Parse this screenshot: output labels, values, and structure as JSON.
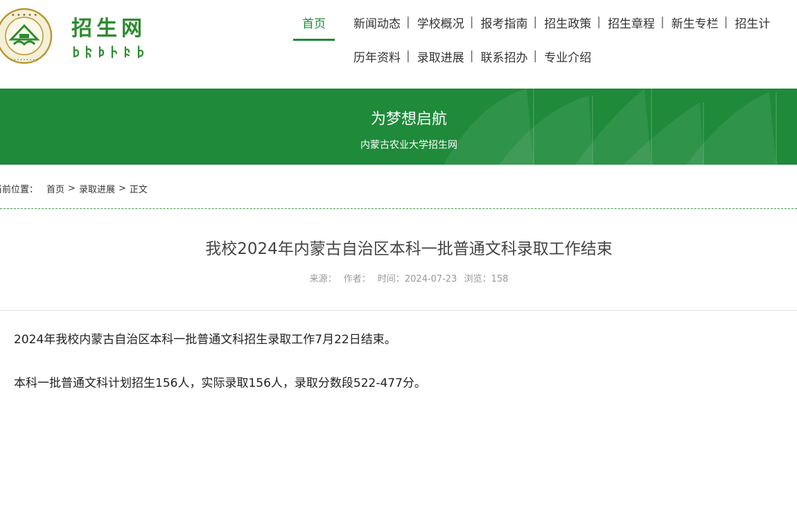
{
  "logo": {
    "title": "招生网"
  },
  "nav": {
    "row1": [
      {
        "label": "首页",
        "active": true
      },
      {
        "label": "新闻动态"
      },
      {
        "label": "学校概况"
      },
      {
        "label": "报考指南"
      },
      {
        "label": "招生政策"
      },
      {
        "label": "招生章程"
      },
      {
        "label": "新生专栏"
      },
      {
        "label": "招生计"
      }
    ],
    "row2": [
      {
        "label": "历年资料"
      },
      {
        "label": "录取进展"
      },
      {
        "label": "联系招办"
      },
      {
        "label": "专业介绍"
      }
    ],
    "separator": "|"
  },
  "banner": {
    "title": "为梦想启航",
    "subtitle": "内蒙古农业大学招生网"
  },
  "breadcrumb": {
    "label": "当前位置：",
    "items": [
      "首页",
      "录取进展",
      "正文"
    ],
    "separator": ">"
  },
  "article": {
    "title": "我校2024年内蒙古自治区本科一批普通文科录取工作结束",
    "meta": {
      "source": "来源：",
      "author": "作者：",
      "time": "时间：2024-07-23",
      "views": "浏览：158"
    },
    "paragraphs": [
      "2024年我校内蒙古自治区本科一批普通文科招生录取工作7月22日结束。",
      "本科一批普通文科计划招生156人，实际录取156人，录取分数段522-477分。"
    ]
  },
  "colors": {
    "brand_green": "#1e8a3a",
    "logo_green": "#2e8b2e",
    "seal_gold": "#b8962e"
  }
}
